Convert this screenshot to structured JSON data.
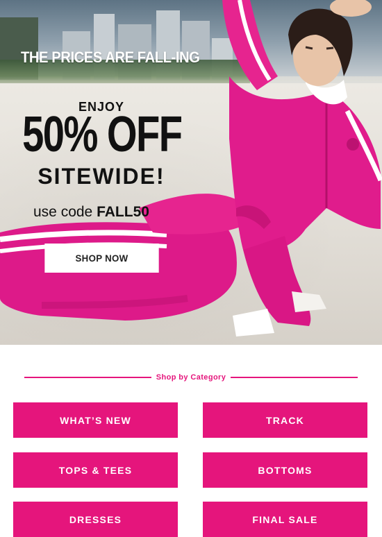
{
  "hero": {
    "tagline": "THE PRICES ARE FALL-ING",
    "enjoy": "ENJOY",
    "discount": "50% OFF",
    "scope": "SITEWIDE!",
    "code_prefix": "use code ",
    "code": "FALL50",
    "cta_label": "SHOP NOW"
  },
  "categories": {
    "heading": "Shop by Category",
    "items": [
      {
        "label": "WHAT’S NEW"
      },
      {
        "label": "TRACK"
      },
      {
        "label": "TOPS & TEES"
      },
      {
        "label": "BOTTOMS"
      },
      {
        "label": "DRESSES"
      },
      {
        "label": "FINAL SALE"
      }
    ]
  },
  "colors": {
    "accent": "#e5157c",
    "velour_pink": "#e01c8c",
    "text_dark": "#111111"
  }
}
